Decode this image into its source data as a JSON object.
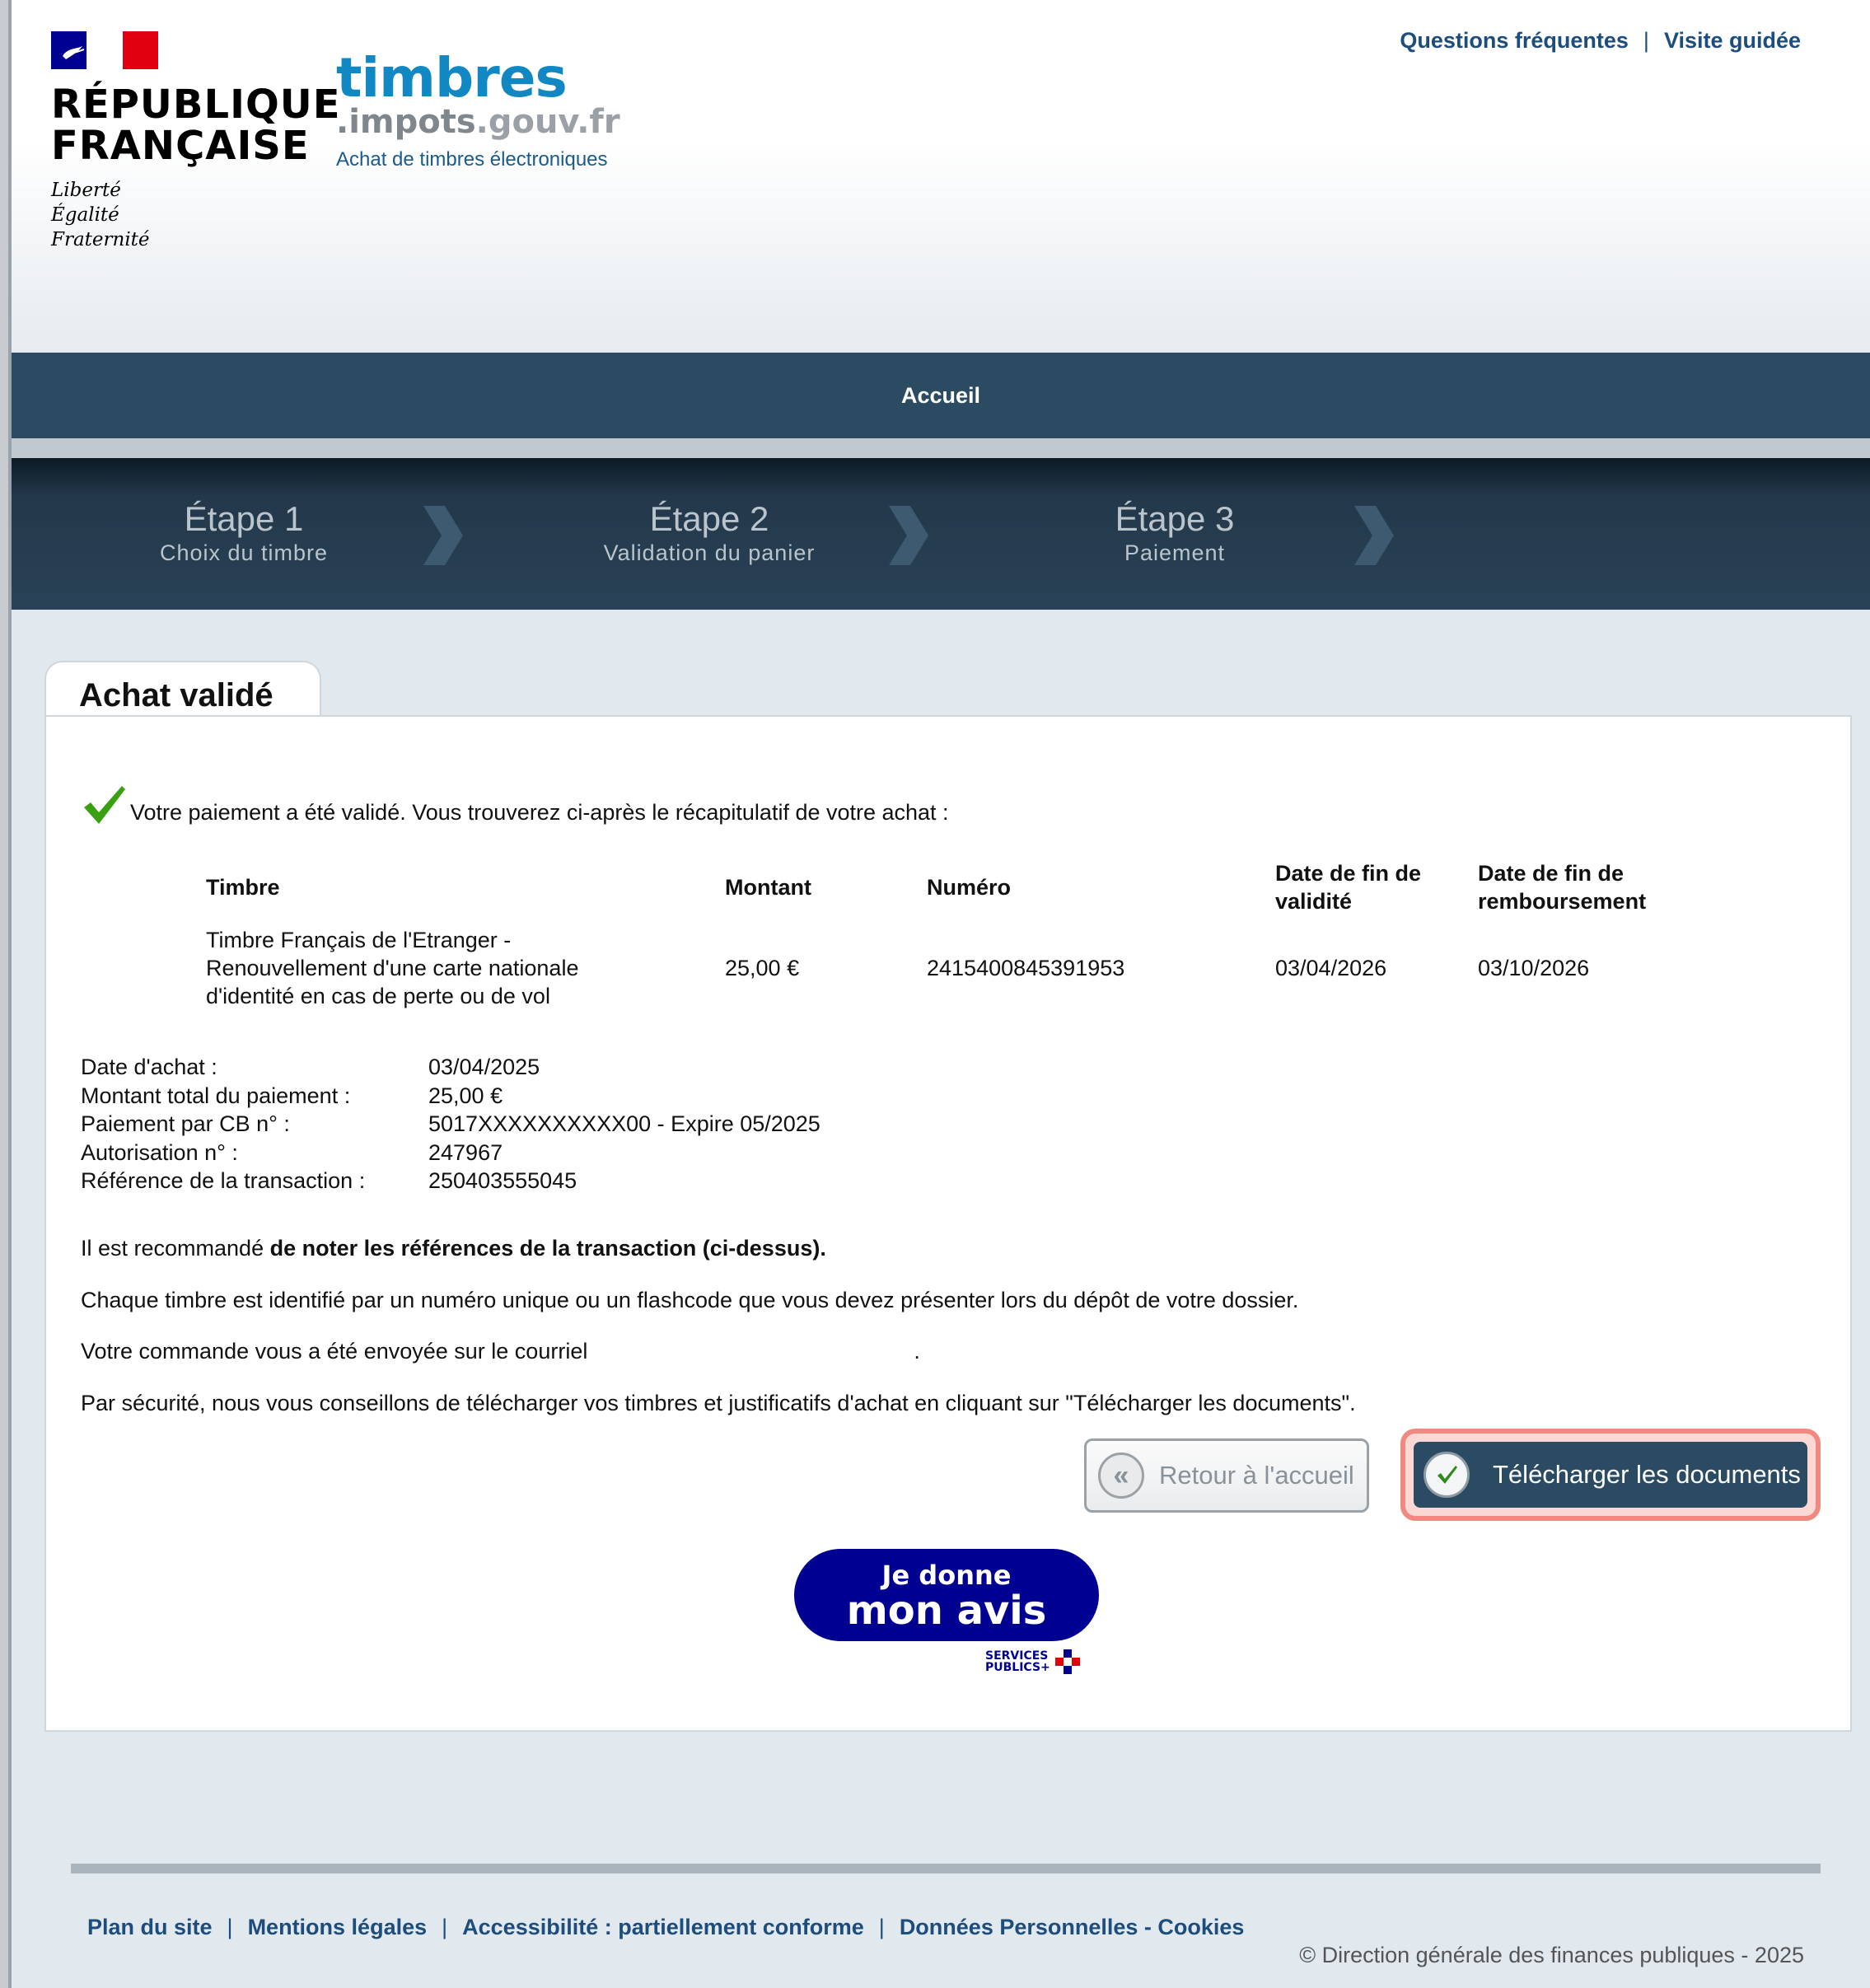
{
  "header": {
    "rf_name_line1": "RÉPUBLIQUE",
    "rf_name_line2": "FRANÇAISE",
    "rf_motto_1": "Liberté",
    "rf_motto_2": "Égalité",
    "rf_motto_3": "Fraternité",
    "site_name": "timbres",
    "site_domain_1": ".impots",
    "site_domain_2": ".gouv.fr",
    "site_subtitle": "Achat de timbres électroniques",
    "links": [
      "Questions fréquentes",
      "Visite guidée"
    ],
    "link_separator": "|"
  },
  "nav": {
    "home": "Accueil"
  },
  "steps": [
    {
      "title": "Étape 1",
      "subtitle": "Choix du timbre"
    },
    {
      "title": "Étape 2",
      "subtitle": "Validation du panier"
    },
    {
      "title": "Étape 3",
      "subtitle": "Paiement"
    }
  ],
  "panel": {
    "tab_title": "Achat validé",
    "success_message": "Votre paiement a été validé. Vous trouverez ci-après le récapitulatif de votre achat :",
    "table": {
      "headers": {
        "timbre": "Timbre",
        "montant": "Montant",
        "numero": "Numéro",
        "date_fin_validite_1": "Date de fin de",
        "date_fin_validite_2": "validité",
        "date_fin_remboursement_1": "Date de fin de",
        "date_fin_remboursement_2": "remboursement"
      },
      "row": {
        "timbre_1": "Timbre Français de l'Etranger -",
        "timbre_2": "Renouvellement d'une carte nationale",
        "timbre_3": "d'identité en cas de perte ou de vol",
        "montant": "25,00 €",
        "numero": "2415400845391953",
        "date_fin_validite": "03/04/2026",
        "date_fin_remboursement": "03/10/2026"
      }
    },
    "details": [
      {
        "label": "Date d'achat :",
        "value": "03/04/2025"
      },
      {
        "label": "Montant total du paiement :",
        "value": "25,00 €"
      },
      {
        "label": "Paiement par CB n° :",
        "value": "5017XXXXXXXXXX00 - Expire 05/2025"
      },
      {
        "label": "Autorisation n° :",
        "value": "247967"
      },
      {
        "label": "Référence de la transaction :",
        "value": "250403555045"
      }
    ],
    "recommendation_prefix": "Il est recommandé ",
    "recommendation_bold": "de noter les références de la transaction (ci-dessus).",
    "para_flashcode": "Chaque timbre est identifié par un numéro unique ou un flashcode que vous devez présenter lors du dépôt de votre dossier.",
    "para_email": "Votre commande vous a été envoyée sur le courriel",
    "para_email_end": ".",
    "para_security": "Par sécurité, nous vous conseillons de télécharger vos timbres et justificatifs d'achat en cliquant sur \"Télécharger les documents\".",
    "btn_back": "Retour à l'accueil",
    "btn_back_icon": "«",
    "btn_download": "Télécharger les documents"
  },
  "avis": {
    "line1": "Je donne",
    "line2": "mon avis",
    "sp_line1": "SERVICES",
    "sp_line2": "PUBLICS+"
  },
  "footer": {
    "links": [
      "Plan du site",
      "Mentions légales",
      "Accessibilité : partiellement conforme",
      "Données Personnelles - Cookies"
    ],
    "separator": "|",
    "copyright": "© Direction générale des finances publiques - 2025"
  },
  "colors": {
    "navbar": "#2b4b63",
    "link": "#1d4d7c",
    "site_blue": "#1188c4",
    "highlight": "#f08a80",
    "check_green": "#3aa012"
  }
}
